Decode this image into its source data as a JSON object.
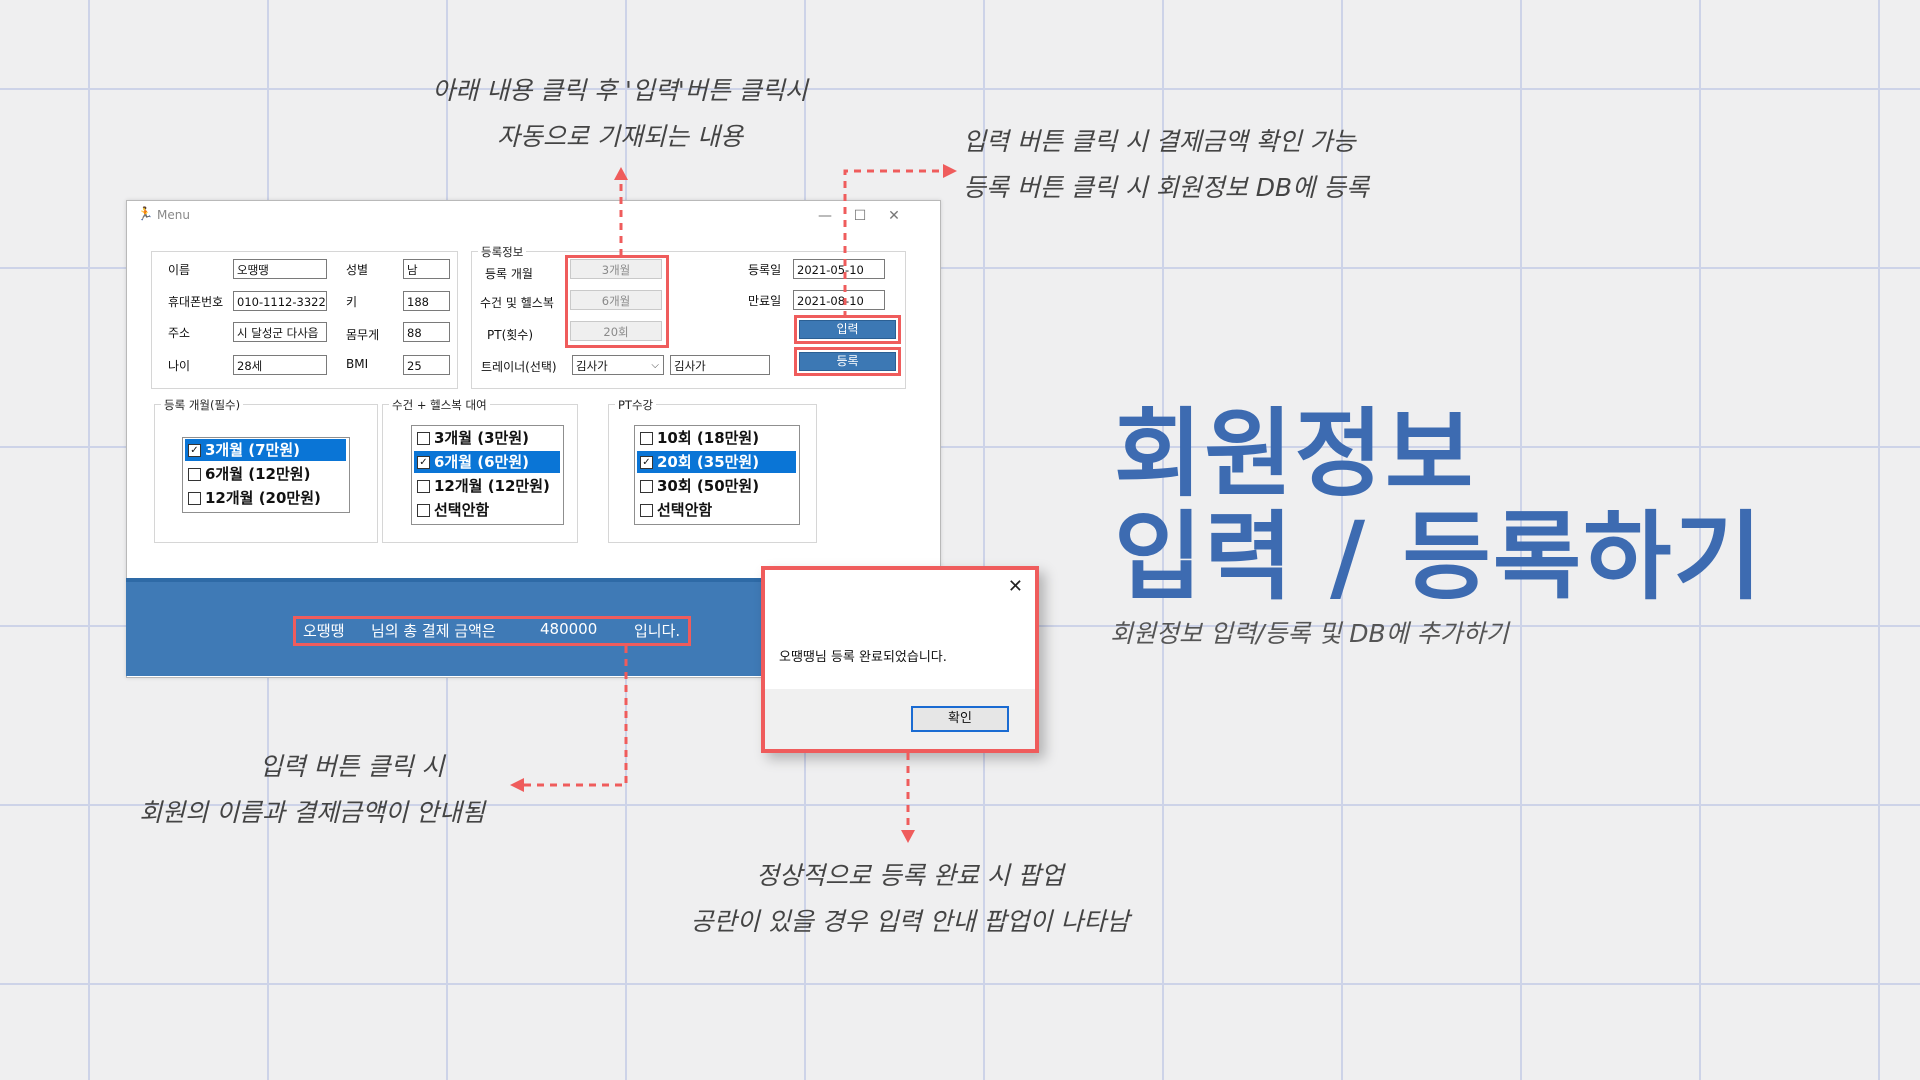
{
  "annotations": {
    "top_center": [
      "아래 내용 클릭 후 '입력'버튼 클릭시",
      "자동으로 기재되는 내용"
    ],
    "top_right": [
      "입력 버튼 클릭 시 결제금액 확인 가능",
      "등록 버튼 클릭 시 회원정보 DB에 등록"
    ],
    "bottom_left": [
      "입력 버튼 클릭 시",
      "회원의 이름과 결제금액이 안내됨"
    ],
    "bottom_center": [
      "정상적으로 등록 완료 시 팝업",
      "공란이 있을 경우 입력 안내 팝업이 나타남"
    ]
  },
  "headline": {
    "line1": "회원정보",
    "line2": "입력 / 등록하기",
    "subtitle": "회원정보 입력/등록 및 DB에 추가하기"
  },
  "window": {
    "title": "Menu",
    "controls": {
      "minimize": "—",
      "maximize": "☐",
      "close": "✕"
    },
    "member": {
      "name_label": "이름",
      "name_value": "오땡땡",
      "phone_label": "휴대폰번호",
      "phone_value": "010-1112-3322",
      "address_label": "주소",
      "address_value": "시 달성군 다사읍",
      "age_label": "나이",
      "age_value": "28세",
      "gender_label": "성별",
      "gender_value": "남",
      "height_label": "키",
      "height_value": "188",
      "weight_label": "몸무게",
      "weight_value": "88",
      "bmi_label": "BMI",
      "bmi_value": "25"
    },
    "registration": {
      "group_title": "등록정보",
      "months_label": "등록 개월",
      "months_value": "3개월",
      "towel_label": "수건 및 헬스복",
      "towel_value": "6개월",
      "pt_label": "PT(횟수)",
      "pt_value": "20회",
      "trainer_label": "트레이너(선택)",
      "trainer_combo": "김사가",
      "trainer_value": "김사가",
      "start_label": "등록일",
      "start_value": "2021-05-10",
      "end_label": "만료일",
      "end_value": "2021-08-10",
      "input_button": "입력",
      "register_button": "등록"
    },
    "groups": [
      {
        "title": "등록 개월(필수)",
        "items": [
          {
            "label": "3개월 (7만원)",
            "checked": true,
            "selected": true
          },
          {
            "label": "6개월 (12만원)",
            "checked": false,
            "selected": false
          },
          {
            "label": "12개월 (20만원)",
            "checked": false,
            "selected": false
          }
        ]
      },
      {
        "title": "수건 + 헬스복 대여",
        "items": [
          {
            "label": "3개월 (3만원)",
            "checked": false,
            "selected": false
          },
          {
            "label": "6개월 (6만원)",
            "checked": true,
            "selected": true
          },
          {
            "label": "12개월 (12만원)",
            "checked": false,
            "selected": false
          },
          {
            "label": "선택안함",
            "checked": false,
            "selected": false
          }
        ]
      },
      {
        "title": "PT수강",
        "items": [
          {
            "label": "10회 (18만원)",
            "checked": false,
            "selected": false
          },
          {
            "label": "20회 (35만원)",
            "checked": true,
            "selected": true
          },
          {
            "label": "30회 (50만원)",
            "checked": false,
            "selected": false
          },
          {
            "label": "선택안함",
            "checked": false,
            "selected": false
          }
        ]
      }
    ],
    "payment_message": {
      "name": "오땡땡",
      "text1": "님의 총 결제 금액은",
      "amount": "480000",
      "text2": "입니다."
    }
  },
  "popup": {
    "message": "오땡땡님 등록 완료되었습니다.",
    "ok_button": "확인",
    "close": "✕"
  },
  "colors": {
    "accent_red": "#ef5c5c",
    "title_blue": "#3d6bb1",
    "bar_blue": "#3f7ab6",
    "select_blue": "#0a75d6"
  }
}
